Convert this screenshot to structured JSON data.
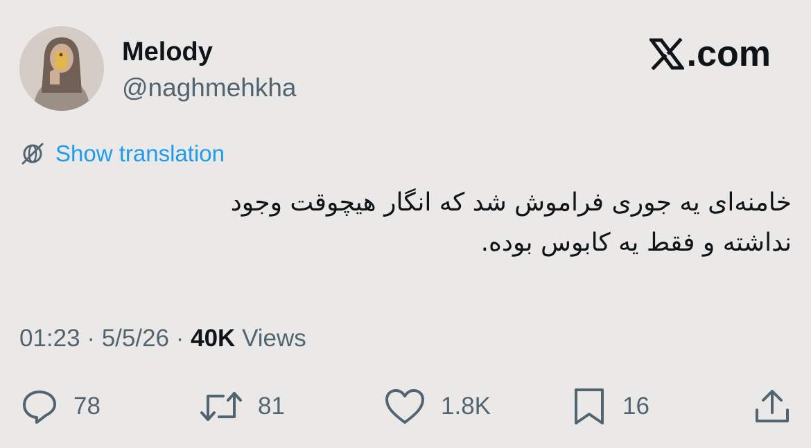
{
  "author": {
    "display_name": "Melody",
    "handle": "@naghmehkha"
  },
  "brand": {
    "label": ".com",
    "icon": "x-logo-icon"
  },
  "translation": {
    "label": "Show translation",
    "icon": "globe-slash-icon"
  },
  "tweet": {
    "line1": "خامنه‌ای یه جوری فراموش شد که انگار هیچوقت وجود",
    "line2": "نداشته و فقط یه کابوس بوده."
  },
  "meta": {
    "time": "01:23",
    "separator1": " · ",
    "date": "5/5/26",
    "separator2": " · ",
    "views_count": "40K",
    "views_label": " Views"
  },
  "actions": {
    "replies": {
      "icon": "reply-icon",
      "count": "78"
    },
    "reposts": {
      "icon": "repost-icon",
      "count": "81"
    },
    "likes": {
      "icon": "heart-icon",
      "count": "1.8K"
    },
    "bookmarks": {
      "icon": "bookmark-icon",
      "count": "16"
    },
    "share": {
      "icon": "share-icon"
    }
  },
  "colors": {
    "background": "#ebe9e7",
    "text": "#0f1419",
    "secondary": "#536471",
    "link": "#1d9bf0"
  }
}
